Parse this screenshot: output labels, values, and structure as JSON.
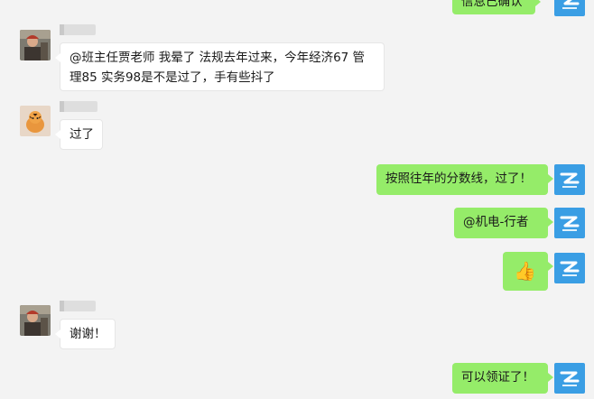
{
  "messages": [
    {
      "side": "right",
      "text": "信息已确认",
      "avatar": "blue-logo-avatar"
    },
    {
      "side": "left",
      "text": "@班主任贾老师  我晕了 法规去年过来，今年经济67 管理85 实务98是不是过了，手有些抖了",
      "avatar": "man-photo-avatar"
    },
    {
      "side": "left",
      "text": "过了",
      "avatar": "tiger-sticker-avatar"
    },
    {
      "side": "right",
      "text": "按照往年的分数线，过了！",
      "avatar": "blue-logo-avatar"
    },
    {
      "side": "right",
      "text": "@机电-行者",
      "avatar": "blue-logo-avatar"
    },
    {
      "side": "right",
      "text": "👍",
      "avatar": "blue-logo-avatar"
    },
    {
      "side": "left",
      "text": "谢谢！",
      "avatar": "man-photo-avatar"
    },
    {
      "side": "right",
      "text": "可以领证了！",
      "avatar": "blue-logo-avatar"
    }
  ],
  "colors": {
    "background": "#f3f3f3",
    "self_bubble": "#95ec69",
    "other_bubble": "#ffffff",
    "brand_avatar": "#3a9ee4"
  }
}
